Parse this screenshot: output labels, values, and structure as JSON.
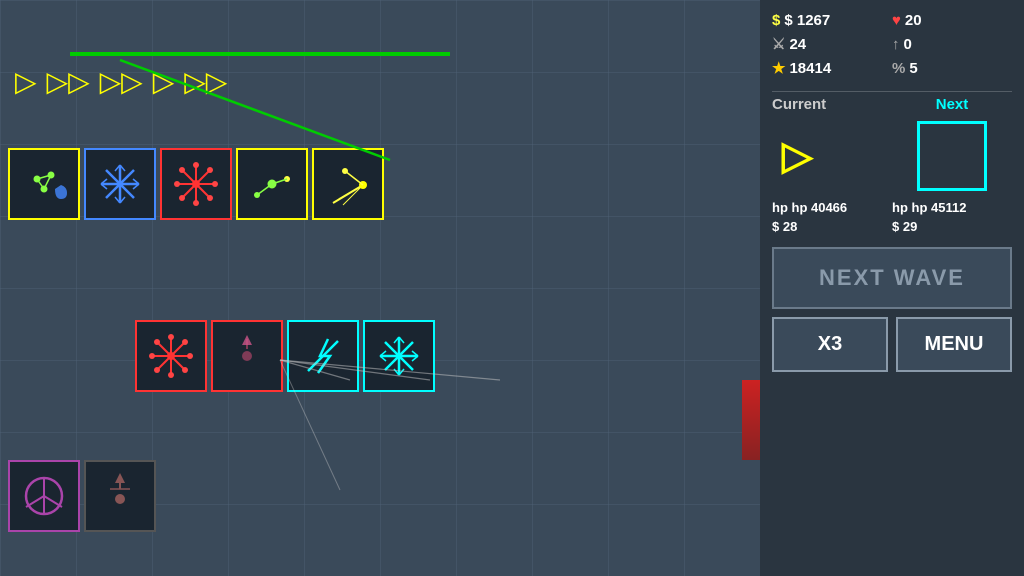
{
  "sidebar": {
    "stats": {
      "money": "$ 1267",
      "hearts": "♥ 20",
      "sword": "24",
      "arrow_up": "0",
      "star": "18414",
      "percent": "% 5"
    },
    "current_label": "Current",
    "next_label": "Next",
    "current_hp": "hp 40466",
    "next_hp": "hp 45112",
    "current_cost": "$ 28",
    "next_cost": "$ 29",
    "next_wave_label": "NEXT WAVE",
    "x3_label": "X3",
    "menu_label": "MENU"
  },
  "game": {
    "grid_cols": 10,
    "grid_rows": 8
  }
}
